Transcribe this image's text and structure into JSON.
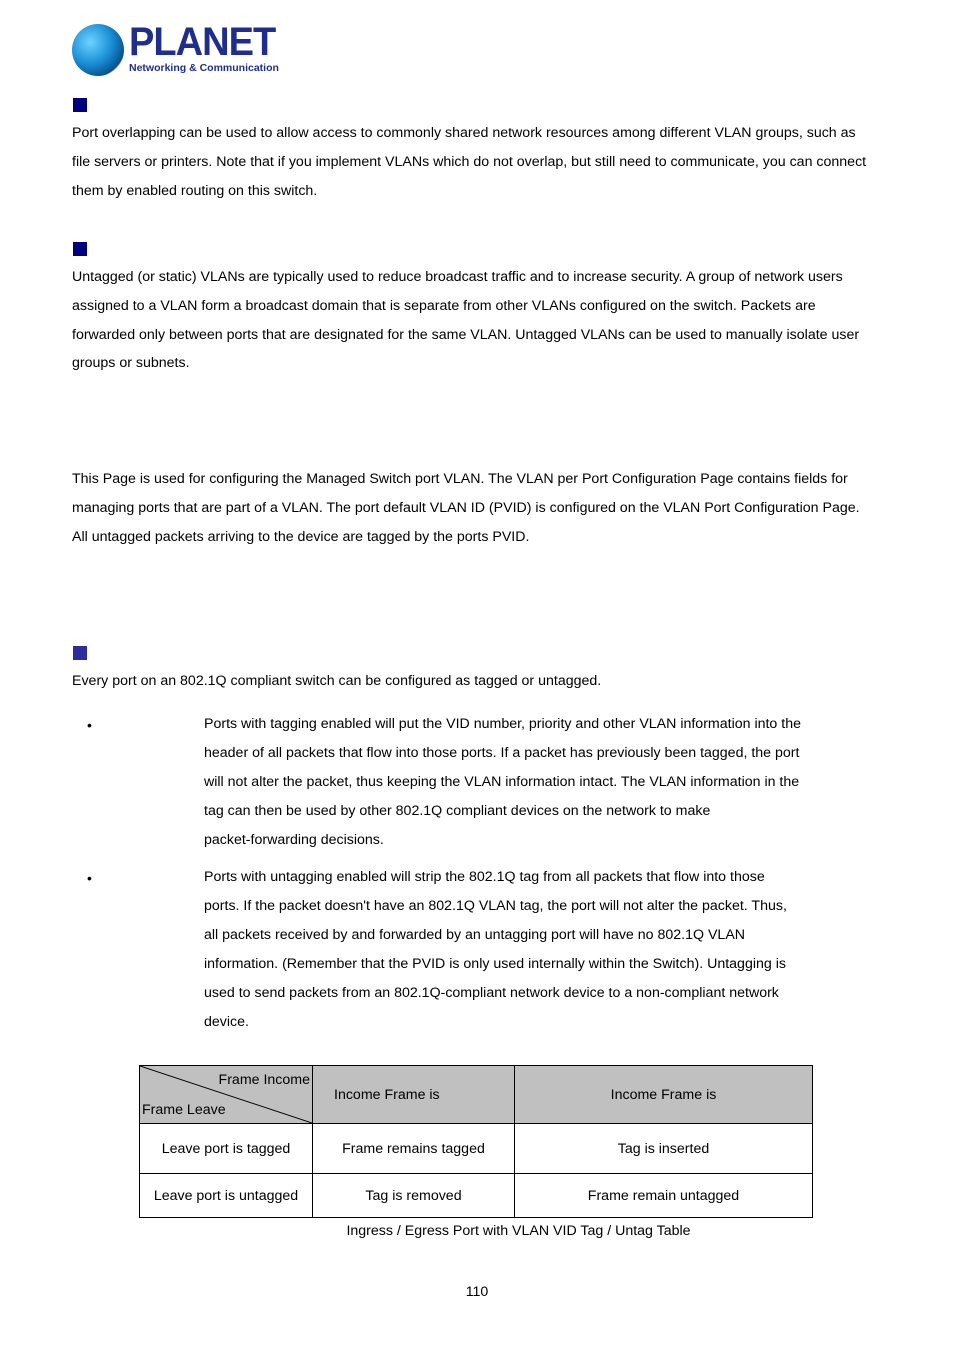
{
  "header": {
    "logo": {
      "brand": "PLANET",
      "tagline": "Networking & Communication",
      "icon": "globe-icon"
    }
  },
  "sections": [
    {
      "marker_icon": "square-bullet-icon",
      "heading": "",
      "paragraph_lines": [
        "Port overlapping can be used to allow access to commonly shared network resources among different VLAN groups, such as",
        "file servers or printers. Note that if you implement VLANs which do not overlap, but still need to communicate, you can connect",
        "them by enabled routing on this switch."
      ]
    },
    {
      "marker_icon": "square-bullet-icon",
      "heading": "",
      "paragraph_lines": [
        "Untagged (or static) VLANs are typically used to reduce broadcast traffic and to increase security. A group of network users",
        "assigned to a VLAN form a broadcast domain that is separate from other VLANs configured on the switch. Packets are",
        "forwarded only between ports that are designated for the same VLAN. Untagged VLANs can be used to manually isolate user",
        "groups or subnets."
      ]
    },
    {
      "heading": "",
      "paragraph_lines": [
        "This Page is used for configuring the Managed Switch port VLAN. The VLAN per Port Configuration Page contains fields for",
        "managing ports that are part of a VLAN. The port default VLAN ID (PVID) is configured on the VLAN Port Configuration Page.",
        "All untagged packets arriving to the device are tagged by the ports PVID."
      ]
    },
    {
      "marker_icon": "square-bullet-icon",
      "heading": "",
      "paragraph_lines": [
        "Every port on an 802.1Q compliant switch can be configured as tagged or untagged."
      ],
      "bullets": [
        {
          "term": "",
          "lines": [
            "Ports with tagging enabled will put the VID number, priority and other VLAN information into the",
            "header of all packets that flow into those ports. If a packet has previously been tagged, the port",
            "will not alter the packet, thus keeping the VLAN information intact. The VLAN information in the",
            "tag can then be used by other 802.1Q compliant devices on the network to make",
            "packet-forwarding decisions."
          ]
        },
        {
          "term": "",
          "lines": [
            "Ports with untagging enabled will strip the 802.1Q tag from all packets that flow into those",
            "ports. If the packet doesn't have an 802.1Q VLAN tag, the port will not alter the packet. Thus,",
            "all packets received by and forwarded by an untagging port will have no 802.1Q VLAN",
            "information. (Remember that the PVID is only used internally within the Switch). Untagging is",
            "used to send packets from an 802.1Q-compliant network device to a non-compliant network",
            "device."
          ]
        }
      ]
    }
  ],
  "table": {
    "corner_top": "Frame Income",
    "corner_bottom": "Frame Leave",
    "headers": [
      "Income Frame is",
      "Income Frame is"
    ],
    "rows": [
      [
        "Leave port is tagged",
        "Frame remains tagged",
        "Tag is inserted"
      ],
      [
        "Leave port is untagged",
        "Tag is removed",
        "Frame remain untagged"
      ]
    ],
    "caption": "Ingress / Egress Port with VLAN VID Tag / Untag Table",
    "header_bg": "#c0c0c0"
  },
  "footer": {
    "page_number": "110"
  },
  "colors": {
    "brand": "#1f2e8c",
    "marker": "#00007f"
  }
}
